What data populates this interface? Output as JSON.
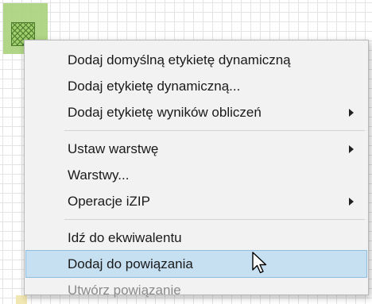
{
  "context_menu": {
    "items": [
      {
        "label": "Dodaj domyślną etykietę dynamiczną"
      },
      {
        "label": "Dodaj etykietę dynamiczną..."
      },
      {
        "label": "Dodaj etykietę wyników obliczeń",
        "submenu": true
      },
      {
        "label": "Ustaw warstwę",
        "submenu": true
      },
      {
        "label": "Warstwy..."
      },
      {
        "label": "Operacje iZIP",
        "submenu": true
      },
      {
        "label": "Idź do ekwiwalentu"
      },
      {
        "label": "Dodaj do powiązania",
        "highlighted": true
      },
      {
        "label": "Utwórz powiązanie",
        "disabled": true
      }
    ]
  },
  "colors": {
    "highlight": "#c6e0f2",
    "selection": "#a9d27a",
    "disabled_text": "#8a8a8a"
  },
  "icons": {
    "cursor": "arrow-pointer-icon",
    "submenu": "chevron-right-icon"
  }
}
